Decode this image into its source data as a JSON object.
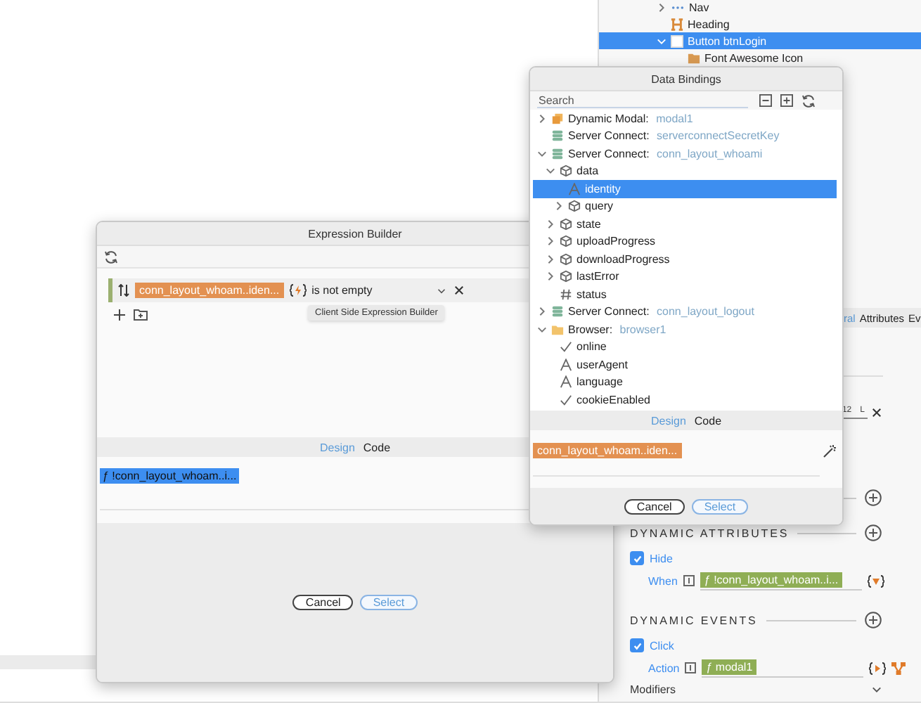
{
  "outline": [
    {
      "kind": "nav",
      "label": "Nav",
      "expanded": false,
      "selected": false
    },
    {
      "kind": "heading",
      "label": "Heading",
      "selected": false
    },
    {
      "kind": "button",
      "label": "Button btnLogin",
      "expanded": true,
      "selected": true,
      "children": [
        {
          "kind": "icon",
          "label": "Font Awesome Icon",
          "selected": false
        }
      ]
    }
  ],
  "properties": {
    "tabs": [
      {
        "label": "ral",
        "selected": true
      },
      {
        "label": "Attributes",
        "selected": false
      },
      {
        "label": "Ev",
        "selected": false
      }
    ],
    "size_field": {
      "value": "12",
      "unit": "L"
    },
    "dynamic_attributes": {
      "title": "DYNAMIC ATTRIBUTES",
      "items": [
        {
          "label": "Hide",
          "checked": true,
          "field_label": "When",
          "value": "ƒ !conn_layout_whoam..i..."
        }
      ]
    },
    "dynamic_events": {
      "title": "DYNAMIC EVENTS",
      "items": [
        {
          "label": "Click",
          "checked": true,
          "field_label": "Action",
          "value": "ƒ modal1"
        }
      ]
    },
    "modifiers": "Modifiers"
  },
  "expression_builder": {
    "title": "Expression Builder",
    "conditions": [
      {
        "binding": "conn_layout_whoam..iden...",
        "operator": "is not empty"
      }
    ],
    "tooltip": "Client Side Expression Builder",
    "tabs": [
      {
        "label": "Design",
        "selected": true
      },
      {
        "label": "Code",
        "selected": false
      }
    ],
    "expression": "ƒ !conn_layout_whoam..i...",
    "buttons": [
      {
        "label": "Cancel",
        "primary": false
      },
      {
        "label": "Select",
        "primary": true
      }
    ]
  },
  "data_bindings": {
    "title": "Data Bindings",
    "search": {
      "placeholder": "Search"
    },
    "tree": [
      {
        "kind": "modal",
        "label": "Dynamic Modal:",
        "name": "modal1",
        "expanded": false,
        "selected": false
      },
      {
        "kind": "server",
        "label": "Server Connect:",
        "name": "serverconnectSecretKey",
        "selected": false
      },
      {
        "kind": "server",
        "label": "Server Connect:",
        "name": "conn_layout_whoami",
        "expanded": true,
        "selected": false,
        "children": [
          {
            "kind": "object",
            "label": "data",
            "expanded": true,
            "selected": false,
            "children": [
              {
                "kind": "text",
                "label": "identity",
                "selected": true
              },
              {
                "kind": "object",
                "label": "query",
                "expanded": false,
                "selected": false
              }
            ]
          },
          {
            "kind": "object",
            "label": "state",
            "expanded": false,
            "selected": false
          },
          {
            "kind": "object",
            "label": "uploadProgress",
            "expanded": false,
            "selected": false
          },
          {
            "kind": "object",
            "label": "downloadProgress",
            "expanded": false,
            "selected": false
          },
          {
            "kind": "object",
            "label": "lastError",
            "expanded": false,
            "selected": false
          },
          {
            "kind": "number",
            "label": "status",
            "selected": false
          }
        ]
      },
      {
        "kind": "server",
        "label": "Server Connect:",
        "name": "conn_layout_logout",
        "expanded": false,
        "selected": false
      },
      {
        "kind": "browser",
        "label": "Browser:",
        "name": "browser1",
        "expanded": true,
        "selected": false,
        "children": [
          {
            "kind": "boolean",
            "label": "online",
            "selected": false
          },
          {
            "kind": "text",
            "label": "userAgent",
            "selected": false
          },
          {
            "kind": "text",
            "label": "language",
            "selected": false
          },
          {
            "kind": "boolean",
            "label": "cookieEnabled",
            "selected": false
          }
        ]
      }
    ],
    "tabs": [
      {
        "label": "Design",
        "selected": true
      },
      {
        "label": "Code",
        "selected": false
      }
    ],
    "expression": "conn_layout_whoam..iden...",
    "buttons": [
      {
        "label": "Cancel",
        "primary": false
      },
      {
        "label": "Select",
        "primary": true
      }
    ]
  }
}
